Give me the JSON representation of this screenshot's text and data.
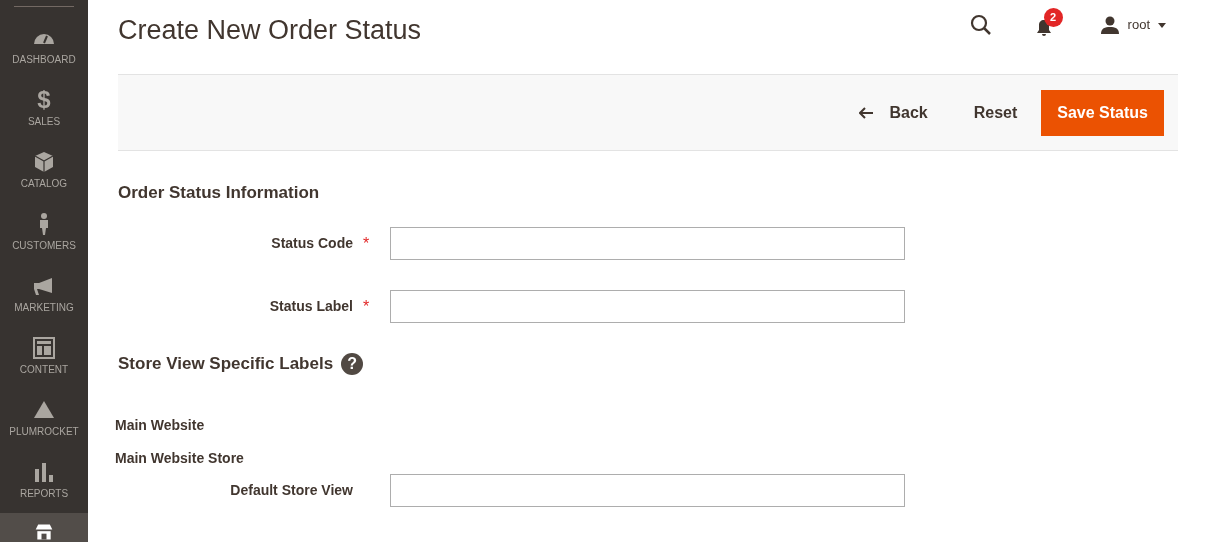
{
  "sidebar": {
    "items": [
      {
        "kind": "dashboard",
        "label": "DASHBOARD",
        "selected": false
      },
      {
        "kind": "sales",
        "glyph": "$",
        "label": "SALES",
        "selected": false
      },
      {
        "kind": "catalog",
        "label": "CATALOG",
        "selected": false
      },
      {
        "kind": "customers",
        "label": "CUSTOMERS",
        "selected": false
      },
      {
        "kind": "marketing",
        "label": "MARKETING",
        "selected": false
      },
      {
        "kind": "content",
        "label": "CONTENT",
        "selected": false
      },
      {
        "kind": "plumrocket",
        "label": "PLUMROCKET",
        "selected": false
      },
      {
        "kind": "reports",
        "label": "REPORTS",
        "selected": false
      },
      {
        "kind": "stores",
        "selected": true
      }
    ]
  },
  "page_title": "Create New Order Status",
  "header": {
    "notifications": "2",
    "user": "root"
  },
  "toolbar": {
    "back": "Back",
    "reset": "Reset",
    "save": "Save Status"
  },
  "section_title": "Order Status Information",
  "required_mark": "*",
  "fields": [
    {
      "label": "Status Code",
      "required": true
    },
    {
      "label": "Status Label",
      "required": true
    }
  ],
  "store_labels": {
    "title": "Store View Specific Labels",
    "help": "?",
    "website": "Main Website",
    "store": "Main Website Store",
    "views": [
      {
        "label": "Default Store View"
      }
    ]
  }
}
